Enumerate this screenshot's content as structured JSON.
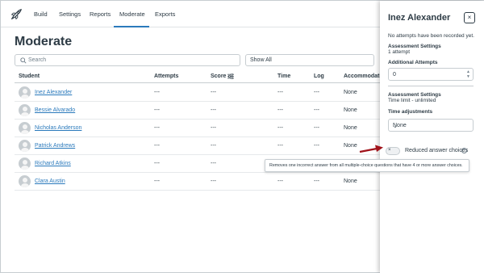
{
  "nav": {
    "tabs": [
      "Build",
      "Settings",
      "Reports",
      "Moderate",
      "Exports"
    ],
    "active_tab": "Moderate"
  },
  "page": {
    "title": "Moderate"
  },
  "search": {
    "placeholder": "Search"
  },
  "filter": {
    "value": "Show All"
  },
  "table": {
    "headers": [
      "Student",
      "Attempts",
      "Score",
      "Time",
      "Log",
      "Accommodatio"
    ],
    "rows": [
      {
        "name": "Inez Alexander",
        "attempts": "---",
        "score": "---",
        "time": "---",
        "log": "---",
        "accommodations": "None"
      },
      {
        "name": "Bessie Alvarado",
        "attempts": "---",
        "score": "---",
        "time": "---",
        "log": "---",
        "accommodations": "None"
      },
      {
        "name": "Nicholas Anderson",
        "attempts": "---",
        "score": "---",
        "time": "---",
        "log": "---",
        "accommodations": "None"
      },
      {
        "name": "Patrick Andrews",
        "attempts": "---",
        "score": "---",
        "time": "---",
        "log": "---",
        "accommodations": "None"
      },
      {
        "name": "Richard Atkins",
        "attempts": "---",
        "score": "---",
        "time": "---",
        "log": "---",
        "accommodations": "None"
      },
      {
        "name": "Clara Austin",
        "attempts": "---",
        "score": "---",
        "time": "---",
        "log": "---",
        "accommodations": "None"
      }
    ]
  },
  "panel": {
    "title": "Inez Alexander",
    "close_label": "×",
    "no_attempts": "No attempts have been recorded yet.",
    "assessment_settings_1": "Assessment Settings",
    "attempts_setting": "1 attempt",
    "additional_attempts_label": "Additional Attempts",
    "additional_attempts_value": "0",
    "assessment_settings_2": "Assessment Settings",
    "time_limit": "Time limit - unlimited",
    "time_adjustments_label": "Time adjustments",
    "time_adjustments_value": "None",
    "toggle_symbol": "×",
    "reduced_choices_label": "Reduced answer choices",
    "info_symbol": "i",
    "tooltip": "Removes one incorrect answer from all multiple-choice questions that have 4 or more answer choices."
  },
  "colors": {
    "link": "#2b7abc",
    "arrow": "#a0121a",
    "text": "#2d3b45"
  }
}
